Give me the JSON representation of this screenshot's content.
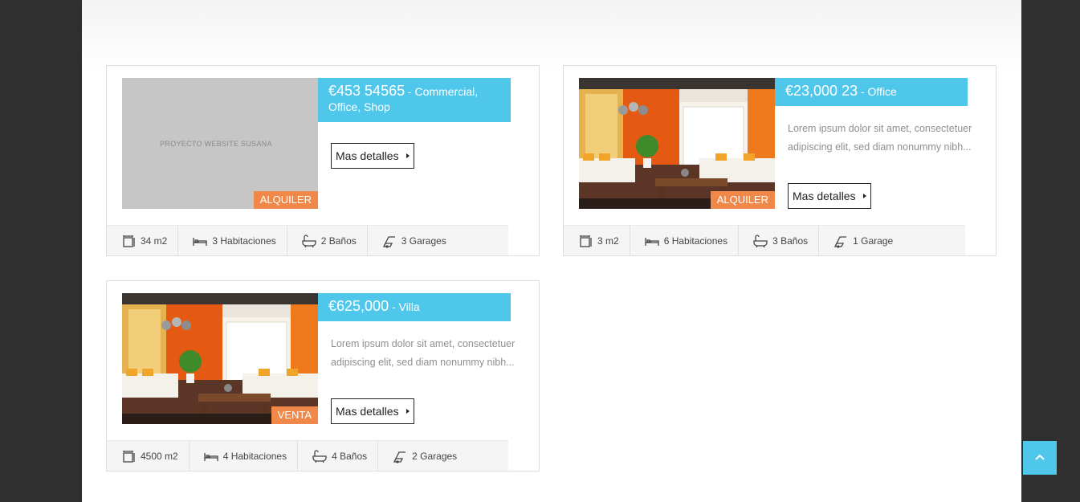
{
  "colors": {
    "accent": "#4ec7eb",
    "badge": "#ef8849",
    "background_dark": "#2f2f2f"
  },
  "listings": [
    {
      "price": "€453 54565",
      "type": " - Commercial, Office, Shop",
      "badge": "ALQUILER",
      "placeholder_text": "PROYECTO WEBSITE SUSANA",
      "button_label": "Mas detalles",
      "features": {
        "area": "34 m2",
        "rooms": "3 Habitaciones",
        "baths": "2 Baños",
        "garages": "3 Garages"
      }
    },
    {
      "price": "€23,000 23",
      "type": " - Office",
      "badge": "ALQUILER",
      "description": "Lorem ipsum dolor sit amet, consectetuer adipiscing elit, sed diam nonummy nibh...",
      "button_label": "Mas detalles",
      "features": {
        "area": "3 m2",
        "rooms": "6 Habitaciones",
        "baths": "3 Baños",
        "garages": "1 Garage"
      }
    },
    {
      "price": "€625,000",
      "type": " - Villa",
      "badge": "VENTA",
      "description": "Lorem ipsum dolor sit amet, consectetuer adipiscing elit, sed diam nonummy nibh...",
      "button_label": "Mas detalles",
      "features": {
        "area": "4500 m2",
        "rooms": "4 Habitaciones",
        "baths": "4 Baños",
        "garages": "2 Garages"
      }
    }
  ],
  "icons": {
    "area": "area-icon",
    "rooms": "bed-icon",
    "baths": "bathtub-icon",
    "garages": "garage-icon",
    "back_to_top": "chevron-up-icon"
  }
}
